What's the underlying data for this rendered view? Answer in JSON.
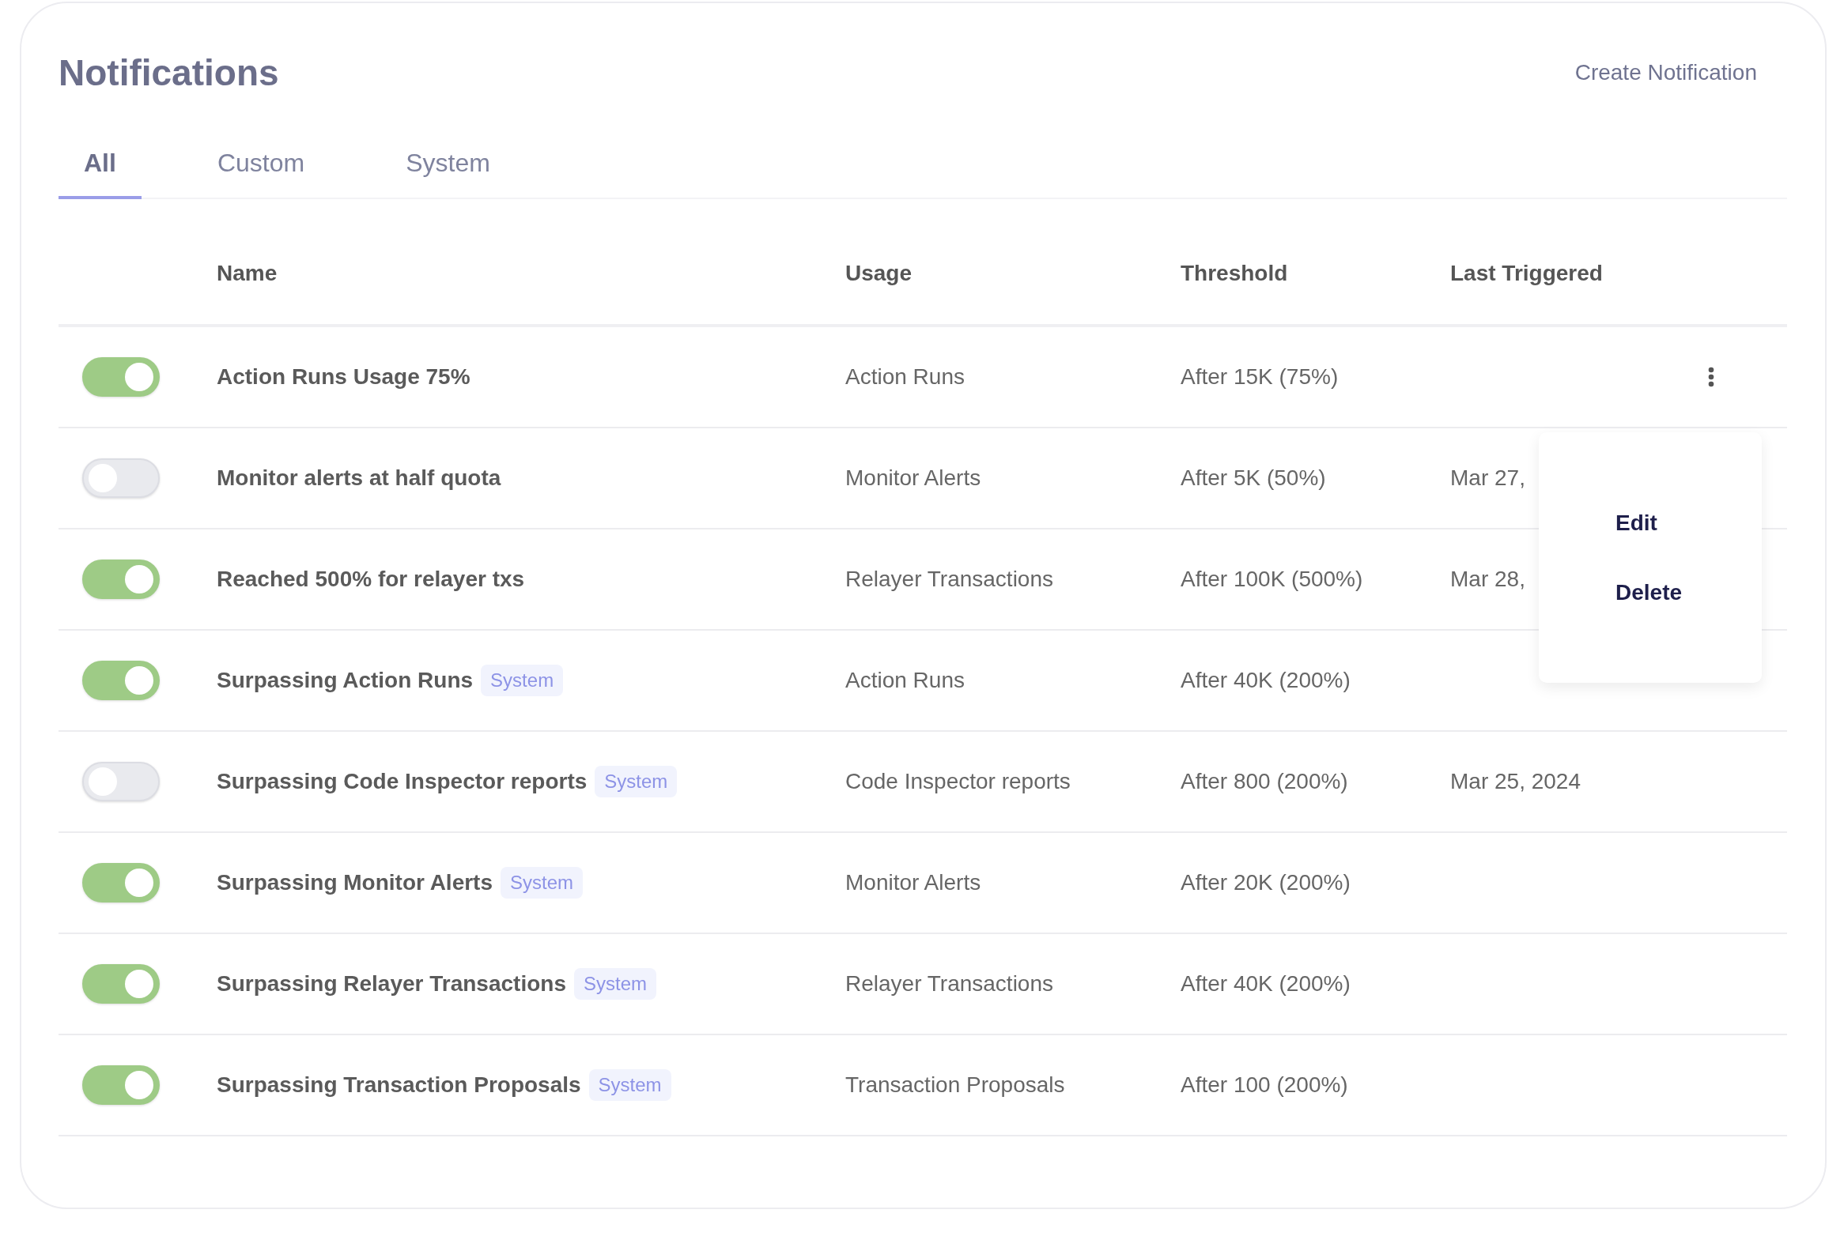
{
  "title": "Notifications",
  "create_button": "Create Notification",
  "tabs": [
    {
      "label": "All",
      "selected": true
    },
    {
      "label": "Custom",
      "selected": false
    },
    {
      "label": "System",
      "selected": false
    }
  ],
  "table": {
    "columns": [
      "Name",
      "Usage",
      "Threshold",
      "Last Triggered"
    ],
    "rows": [
      {
        "on": true,
        "name": "Action Runs Usage 75%",
        "usage": "Action Runs",
        "threshold": "After 15K (75%)",
        "more_button": true
      },
      {
        "on": false,
        "name": "Monitor alerts at half quota",
        "usage": "Monitor Alerts",
        "threshold": "After 5K (50%)",
        "last_triggered": "Mar 27,",
        "more_button": false
      },
      {
        "on": true,
        "name": "Reached 500% for relayer txs",
        "usage": "Relayer Transactions",
        "threshold": "After 100K (500%)",
        "last_triggered": "Mar 28,",
        "more_button": false
      },
      {
        "on": true,
        "name": "Surpassing Action Runs",
        "badge": "System",
        "usage": "Action Runs",
        "threshold": "After 40K (200%)",
        "more_button": false
      },
      {
        "on": false,
        "name": "Surpassing Code Inspector reports",
        "badge": "System",
        "usage": "Code Inspector reports",
        "threshold": "After 800 (200%)",
        "last_triggered": "Mar 25, 2024",
        "more_button": false
      },
      {
        "on": true,
        "name": "Surpassing Monitor Alerts",
        "badge": "System",
        "usage": "Monitor Alerts",
        "threshold": "After 20K (200%)",
        "more_button": false
      },
      {
        "on": true,
        "name": "Surpassing Relayer Transactions",
        "badge": "System",
        "usage": "Relayer Transactions",
        "threshold": "After 40K (200%)",
        "more_button": false
      },
      {
        "on": true,
        "name": "Surpassing Transaction Proposals",
        "badge": "System",
        "usage": "Transaction Proposals",
        "threshold": "After 100 (200%)",
        "more_button": false
      }
    ]
  },
  "menu": {
    "items": [
      "Edit",
      "Delete"
    ]
  }
}
